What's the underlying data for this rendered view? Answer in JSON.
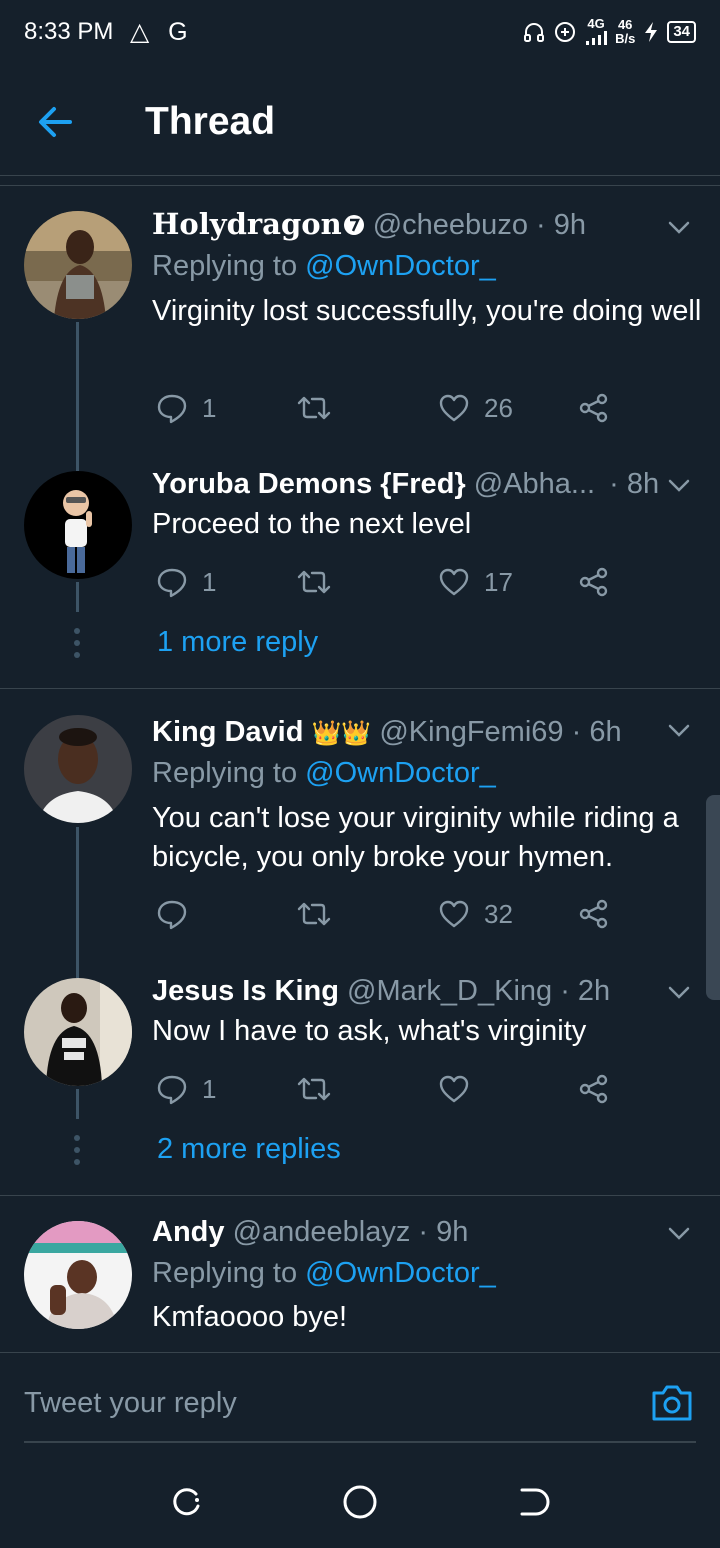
{
  "status_bar": {
    "time": "8:33 PM",
    "left_icons": "△ G",
    "net_speed_top": "46",
    "net_speed_bottom": "B/s",
    "network_type": "4G",
    "battery": "34"
  },
  "header": {
    "title": "Thread"
  },
  "tweets": [
    {
      "name": "Holydragon",
      "handle": "@cheebuzo",
      "time": "· 9h",
      "replying_label": "Replying to ",
      "replying_to": "@OwnDoctor_",
      "text": "Virginity lost successfully, you're doing well",
      "replies": "1",
      "retweets": "",
      "likes": "26"
    },
    {
      "name": "Yoruba Demons {Fred}",
      "handle": "@Abha...",
      "time": "· 8h",
      "text": "Proceed to the next level",
      "replies": "1",
      "retweets": "",
      "likes": "17",
      "more_replies": "1 more reply"
    },
    {
      "name": "King David",
      "name_emoji": "👑👑",
      "handle": "@KingFemi69",
      "time": "· 6h",
      "replying_label": "Replying to ",
      "replying_to": "@OwnDoctor_",
      "text": "You can't lose your virginity while riding a bicycle, you only broke your hymen.",
      "replies": "",
      "retweets": "",
      "likes": "32"
    },
    {
      "name": "Jesus Is King",
      "handle": "@Mark_D_King",
      "time": "· 2h",
      "text": "Now I have to ask, what's virginity",
      "replies": "1",
      "retweets": "",
      "likes": "",
      "more_replies": "2 more replies"
    },
    {
      "name": "Andy",
      "handle": "@andeeblayz",
      "time": "· 9h",
      "replying_label": "Replying to ",
      "replying_to": "@OwnDoctor_",
      "text": "Kmfaoooo bye!"
    }
  ],
  "reply_box": {
    "placeholder": "Tweet your reply"
  },
  "colors": {
    "background": "#15202b",
    "accent": "#1da1f2",
    "secondary_text": "#8899a6",
    "divider": "#38444d"
  },
  "icons": {
    "back": "arrow-left-icon",
    "reply": "speech-bubble-icon",
    "retweet": "retweet-icon",
    "like": "heart-icon",
    "share": "share-icon",
    "more": "chevron-down-icon",
    "camera": "camera-icon",
    "verified_badge": "number-7-badge-icon"
  }
}
